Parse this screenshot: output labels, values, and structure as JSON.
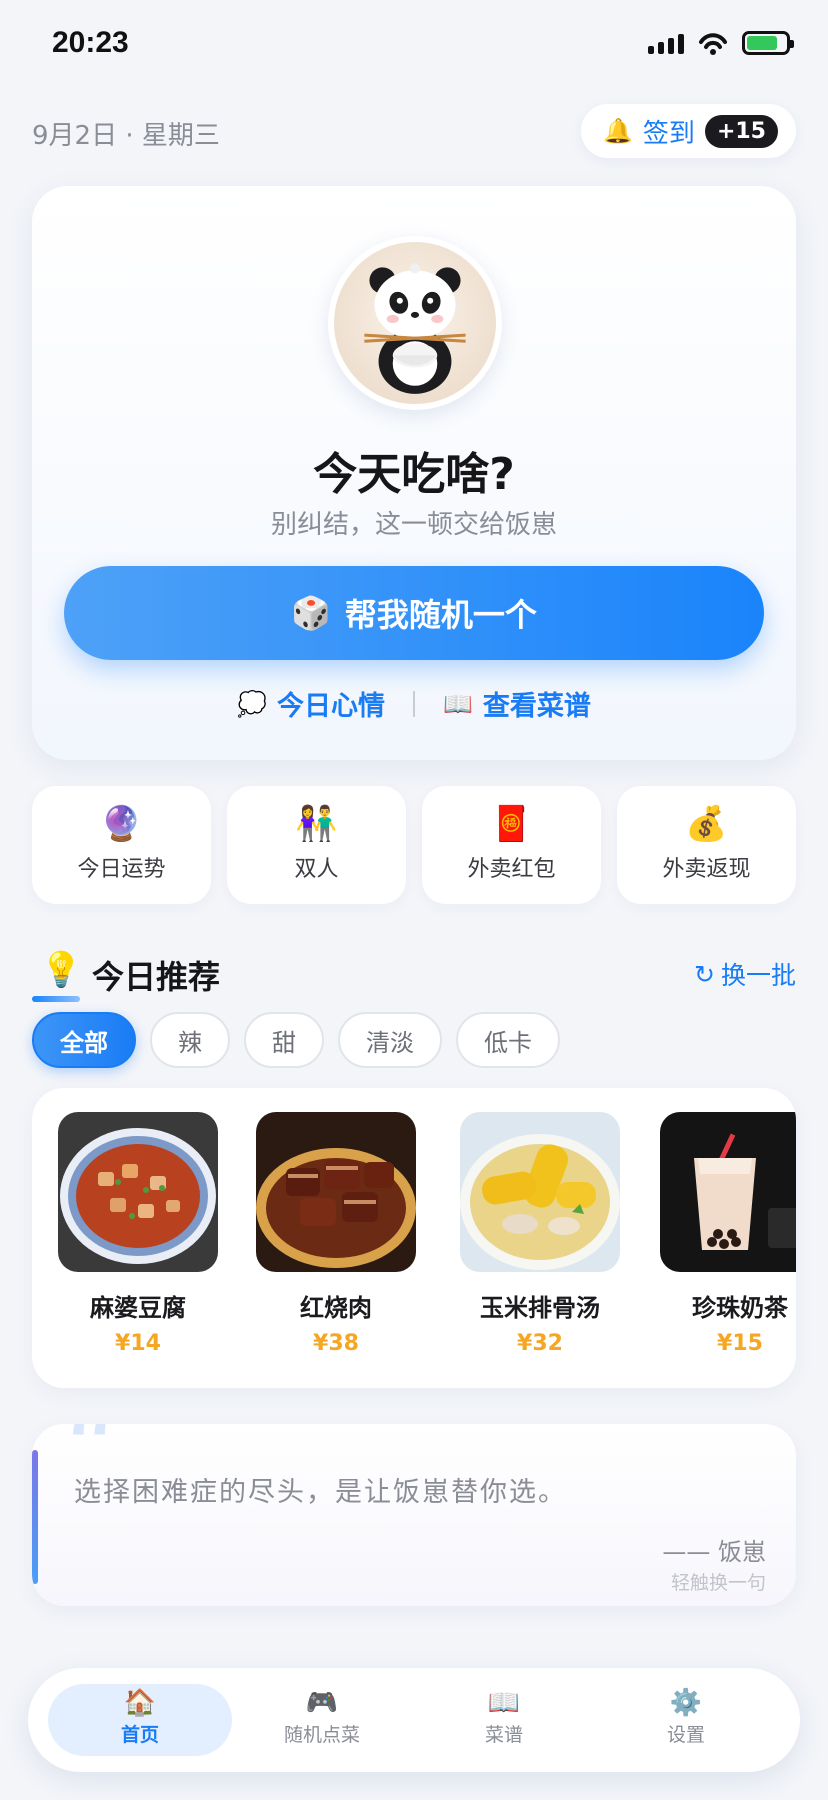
{
  "status_bar": {
    "time": "20:23"
  },
  "header": {
    "date": "9月2日 · 星期三",
    "signin_label": "签到",
    "signin_badge": "+15"
  },
  "hero": {
    "title": "今天吃啥?",
    "subtitle": "别纠结，这一顿交给饭崽",
    "random_button": "帮我随机一个",
    "link_mood": "今日心情",
    "link_menu": "查看菜谱"
  },
  "quick_actions": [
    {
      "label": "今日运势",
      "icon": "crystal-ball-icon",
      "glyph": "🔮"
    },
    {
      "label": "双人",
      "icon": "couple-icon",
      "glyph": "👫"
    },
    {
      "label": "外卖红包",
      "icon": "red-envelope-icon",
      "glyph": "🧧"
    },
    {
      "label": "外卖返现",
      "icon": "money-bag-icon",
      "glyph": "💰"
    }
  ],
  "recommend": {
    "title": "今日推荐",
    "refresh_label": "换一批",
    "filters": [
      "全部",
      "辣",
      "甜",
      "清淡",
      "低卡"
    ],
    "active_filter": "全部",
    "dishes": [
      {
        "name": "麻婆豆腐",
        "price": "¥14"
      },
      {
        "name": "红烧肉",
        "price": "¥38"
      },
      {
        "name": "玉米排骨汤",
        "price": "¥32"
      },
      {
        "name": "珍珠奶茶",
        "price": "¥15"
      }
    ]
  },
  "quote": {
    "text": "选择困难症的尽头，是让饭崽替你选。",
    "author": "—— 饭崽",
    "hint": "轻触换一句"
  },
  "tabbar": {
    "items": [
      {
        "label": "首页",
        "icon": "home-icon",
        "glyph": "🏠"
      },
      {
        "label": "随机点菜",
        "icon": "gamepad-icon",
        "glyph": "🎮"
      },
      {
        "label": "菜谱",
        "icon": "book-icon",
        "glyph": "📖"
      },
      {
        "label": "设置",
        "icon": "gear-icon",
        "glyph": "⚙️"
      }
    ],
    "active": "首页"
  },
  "colors": {
    "accent": "#1a7cf5",
    "price": "#f5a623",
    "background": "#f3f5f9"
  }
}
